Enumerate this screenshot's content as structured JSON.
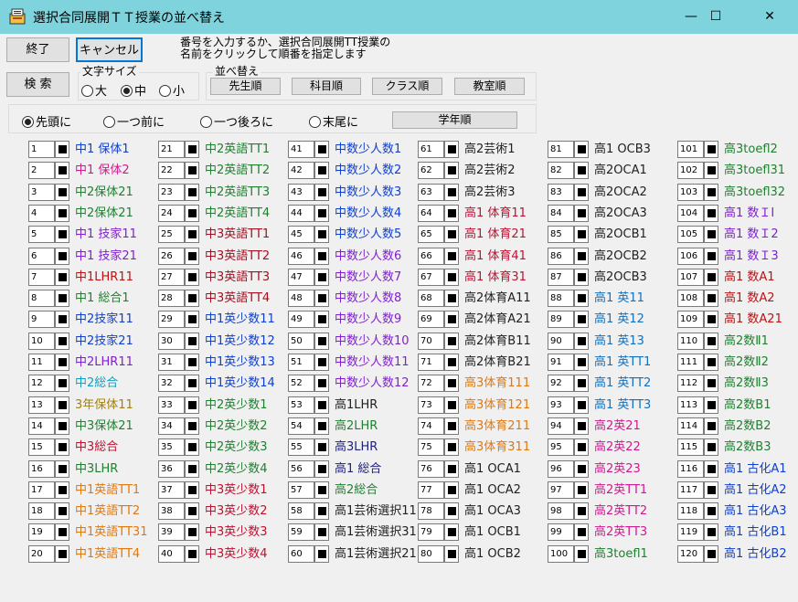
{
  "window": {
    "title": "選択合同展開ＴＴ授業の並べ替え",
    "minimize": "—",
    "maximize": "☐",
    "close": "✕"
  },
  "buttons": {
    "exit": "終了",
    "cancel": "キャンセル",
    "search": "検 索"
  },
  "instruction": "番号を入力するか、選択合同展開TT授業の\n名前をクリックして順番を指定します",
  "font_size": {
    "title": "文字サイズ",
    "options": [
      "大",
      "中",
      "小"
    ],
    "selected": "中"
  },
  "sort": {
    "title": "並べ替え",
    "buttons": [
      "先生順",
      "科目順",
      "クラス順",
      "教室順"
    ],
    "grade_button": "学年順"
  },
  "position": {
    "options": [
      "先頭に",
      "一つ前に",
      "一つ後ろに",
      "末尾に"
    ],
    "selected": "先頭に"
  },
  "colors": {
    "titlebar": "#7fd3dd",
    "window_bg": "#f0f0f0"
  },
  "columns": [
    [
      {
        "n": "1",
        "label": "中1 保体1",
        "color": "#1040d0"
      },
      {
        "n": "2",
        "label": "中1 保体2",
        "color": "#d01890"
      },
      {
        "n": "3",
        "label": "中2保体21",
        "color": "#208030"
      },
      {
        "n": "4",
        "label": "中2保体21",
        "color": "#208030"
      },
      {
        "n": "5",
        "label": "中1 技家11",
        "color": "#8020d0"
      },
      {
        "n": "6",
        "label": "中1 技家21",
        "color": "#8020d0"
      },
      {
        "n": "7",
        "label": "中1LHR11",
        "color": "#c01010"
      },
      {
        "n": "8",
        "label": "中1 総合1",
        "color": "#208030"
      },
      {
        "n": "9",
        "label": "中2技家11",
        "color": "#1040d0"
      },
      {
        "n": "10",
        "label": "中2技家21",
        "color": "#1040d0"
      },
      {
        "n": "11",
        "label": "中2LHR11",
        "color": "#8020d0"
      },
      {
        "n": "12",
        "label": "中2総合",
        "color": "#10a0c0"
      },
      {
        "n": "13",
        "label": "3年保体11",
        "color": "#a08010"
      },
      {
        "n": "14",
        "label": "中3保体21",
        "color": "#208030"
      },
      {
        "n": "15",
        "label": "中3総合",
        "color": "#c01030"
      },
      {
        "n": "16",
        "label": "中3LHR",
        "color": "#208030"
      },
      {
        "n": "17",
        "label": "中1英語TT1",
        "color": "#e07810"
      },
      {
        "n": "18",
        "label": "中1英語TT2",
        "color": "#e07810"
      },
      {
        "n": "19",
        "label": "中1英語TT31",
        "color": "#e07810"
      },
      {
        "n": "20",
        "label": "中1英語TT4",
        "color": "#e07810"
      }
    ],
    [
      {
        "n": "21",
        "label": "中2英語TT1",
        "color": "#208030"
      },
      {
        "n": "22",
        "label": "中2英語TT2",
        "color": "#208030"
      },
      {
        "n": "23",
        "label": "中2英語TT3",
        "color": "#208030"
      },
      {
        "n": "24",
        "label": "中2英語TT4",
        "color": "#208030"
      },
      {
        "n": "25",
        "label": "中3英語TT1",
        "color": "#a01020"
      },
      {
        "n": "26",
        "label": "中3英語TT2",
        "color": "#a01020"
      },
      {
        "n": "27",
        "label": "中3英語TT3",
        "color": "#a01020"
      },
      {
        "n": "28",
        "label": "中3英語TT4",
        "color": "#a01020"
      },
      {
        "n": "29",
        "label": "中1英少数11",
        "color": "#1040d0"
      },
      {
        "n": "30",
        "label": "中1英少数12",
        "color": "#1040d0"
      },
      {
        "n": "31",
        "label": "中1英少数13",
        "color": "#1040d0"
      },
      {
        "n": "32",
        "label": "中1英少数14",
        "color": "#1040d0"
      },
      {
        "n": "33",
        "label": "中2英少数1",
        "color": "#208030"
      },
      {
        "n": "34",
        "label": "中2英少数2",
        "color": "#208030"
      },
      {
        "n": "35",
        "label": "中2英少数3",
        "color": "#208030"
      },
      {
        "n": "36",
        "label": "中2英少数4",
        "color": "#208030"
      },
      {
        "n": "37",
        "label": "中3英少数1",
        "color": "#c01030"
      },
      {
        "n": "38",
        "label": "中3英少数2",
        "color": "#c01030"
      },
      {
        "n": "39",
        "label": "中3英少数3",
        "color": "#c01030"
      },
      {
        "n": "40",
        "label": "中3英少数4",
        "color": "#c01030"
      }
    ],
    [
      {
        "n": "41",
        "label": "中数少人数1",
        "color": "#1040d0"
      },
      {
        "n": "42",
        "label": "中数少人数2",
        "color": "#1040d0"
      },
      {
        "n": "43",
        "label": "中数少人数3",
        "color": "#1040d0"
      },
      {
        "n": "44",
        "label": "中数少人数4",
        "color": "#1040d0"
      },
      {
        "n": "45",
        "label": "中数少人数5",
        "color": "#1040d0"
      },
      {
        "n": "46",
        "label": "中数少人数6",
        "color": "#8020d0"
      },
      {
        "n": "47",
        "label": "中数少人数7",
        "color": "#8020d0"
      },
      {
        "n": "48",
        "label": "中数少人数8",
        "color": "#8020d0"
      },
      {
        "n": "49",
        "label": "中数少人数9",
        "color": "#8020d0"
      },
      {
        "n": "50",
        "label": "中数少人数10",
        "color": "#8020d0"
      },
      {
        "n": "51",
        "label": "中数少人数11",
        "color": "#8020d0"
      },
      {
        "n": "52",
        "label": "中数少人数12",
        "color": "#8020d0"
      },
      {
        "n": "53",
        "label": "高1LHR",
        "color": "#202020"
      },
      {
        "n": "54",
        "label": "高2LHR",
        "color": "#208030"
      },
      {
        "n": "55",
        "label": "高3LHR",
        "color": "#202080"
      },
      {
        "n": "56",
        "label": "高1 総合",
        "color": "#202080"
      },
      {
        "n": "57",
        "label": "高2総合",
        "color": "#208030"
      },
      {
        "n": "58",
        "label": "高1芸術選択11",
        "color": "#202020"
      },
      {
        "n": "59",
        "label": "高1芸術選択31",
        "color": "#202020"
      },
      {
        "n": "60",
        "label": "高1芸術選択21",
        "color": "#202020"
      }
    ],
    [
      {
        "n": "61",
        "label": "高2芸術1",
        "color": "#202020"
      },
      {
        "n": "62",
        "label": "高2芸術2",
        "color": "#202020"
      },
      {
        "n": "63",
        "label": "高2芸術3",
        "color": "#202020"
      },
      {
        "n": "64",
        "label": "高1 体育11",
        "color": "#c01030"
      },
      {
        "n": "65",
        "label": "高1 体育21",
        "color": "#c01030"
      },
      {
        "n": "66",
        "label": "高1 体育41",
        "color": "#c01030"
      },
      {
        "n": "67",
        "label": "高1 体育31",
        "color": "#c01030"
      },
      {
        "n": "68",
        "label": "高2体育A11",
        "color": "#202020"
      },
      {
        "n": "69",
        "label": "高2体育A21",
        "color": "#202020"
      },
      {
        "n": "70",
        "label": "高2体育B11",
        "color": "#202020"
      },
      {
        "n": "71",
        "label": "高2体育B21",
        "color": "#202020"
      },
      {
        "n": "72",
        "label": "高3体育111",
        "color": "#e07810"
      },
      {
        "n": "73",
        "label": "高3体育121",
        "color": "#e07810"
      },
      {
        "n": "74",
        "label": "高3体育211",
        "color": "#e07810"
      },
      {
        "n": "75",
        "label": "高3体育311",
        "color": "#e07810"
      },
      {
        "n": "76",
        "label": "高1 OCA1",
        "color": "#202020"
      },
      {
        "n": "77",
        "label": "高1 OCA2",
        "color": "#202020"
      },
      {
        "n": "78",
        "label": "高1 OCA3",
        "color": "#202020"
      },
      {
        "n": "79",
        "label": "高1 OCB1",
        "color": "#202020"
      },
      {
        "n": "80",
        "label": "高1 OCB2",
        "color": "#202020"
      }
    ],
    [
      {
        "n": "81",
        "label": "高1 OCB3",
        "color": "#202020"
      },
      {
        "n": "82",
        "label": "高2OCA1",
        "color": "#202020"
      },
      {
        "n": "83",
        "label": "高2OCA2",
        "color": "#202020"
      },
      {
        "n": "84",
        "label": "高2OCA3",
        "color": "#202020"
      },
      {
        "n": "85",
        "label": "高2OCB1",
        "color": "#202020"
      },
      {
        "n": "86",
        "label": "高2OCB2",
        "color": "#202020"
      },
      {
        "n": "87",
        "label": "高2OCB3",
        "color": "#202020"
      },
      {
        "n": "88",
        "label": "高1 英11",
        "color": "#1070c0"
      },
      {
        "n": "89",
        "label": "高1 英12",
        "color": "#1070c0"
      },
      {
        "n": "90",
        "label": "高1 英13",
        "color": "#1070c0"
      },
      {
        "n": "91",
        "label": "高1 英TT1",
        "color": "#1070c0"
      },
      {
        "n": "92",
        "label": "高1 英TT2",
        "color": "#1070c0"
      },
      {
        "n": "93",
        "label": "高1 英TT3",
        "color": "#1070c0"
      },
      {
        "n": "94",
        "label": "高2英21",
        "color": "#d01890"
      },
      {
        "n": "95",
        "label": "高2英22",
        "color": "#d01890"
      },
      {
        "n": "96",
        "label": "高2英23",
        "color": "#d01890"
      },
      {
        "n": "97",
        "label": "高2英TT1",
        "color": "#d01890"
      },
      {
        "n": "98",
        "label": "高2英TT2",
        "color": "#d01890"
      },
      {
        "n": "99",
        "label": "高2英TT3",
        "color": "#d01890"
      },
      {
        "n": "100",
        "label": "高3toefl1",
        "color": "#208030"
      }
    ],
    [
      {
        "n": "101",
        "label": "高3toefl2",
        "color": "#208030"
      },
      {
        "n": "102",
        "label": "高3toefl31",
        "color": "#208030"
      },
      {
        "n": "103",
        "label": "高3toefl32",
        "color": "#208030"
      },
      {
        "n": "104",
        "label": "高1 数ＩⅠ",
        "color": "#8020d0"
      },
      {
        "n": "105",
        "label": "高1 数Ｉ2",
        "color": "#8020d0"
      },
      {
        "n": "106",
        "label": "高1 数Ｉ3",
        "color": "#8020d0"
      },
      {
        "n": "107",
        "label": "高1 数A1",
        "color": "#c01010"
      },
      {
        "n": "108",
        "label": "高1 数A2",
        "color": "#c01010"
      },
      {
        "n": "109",
        "label": "高1 数A21",
        "color": "#c01010"
      },
      {
        "n": "110",
        "label": "高2数Ⅱ1",
        "color": "#208030"
      },
      {
        "n": "111",
        "label": "高2数Ⅱ2",
        "color": "#208030"
      },
      {
        "n": "112",
        "label": "高2数Ⅱ3",
        "color": "#208030"
      },
      {
        "n": "113",
        "label": "高2数B1",
        "color": "#208030"
      },
      {
        "n": "114",
        "label": "高2数B2",
        "color": "#208030"
      },
      {
        "n": "115",
        "label": "高2数B3",
        "color": "#208030"
      },
      {
        "n": "116",
        "label": "高1 古化A1",
        "color": "#1040d0"
      },
      {
        "n": "117",
        "label": "高1 古化A2",
        "color": "#1040d0"
      },
      {
        "n": "118",
        "label": "高1 古化A3",
        "color": "#1040d0"
      },
      {
        "n": "119",
        "label": "高1 古化B1",
        "color": "#1040d0"
      },
      {
        "n": "120",
        "label": "高1 古化B2",
        "color": "#1040d0"
      }
    ]
  ]
}
